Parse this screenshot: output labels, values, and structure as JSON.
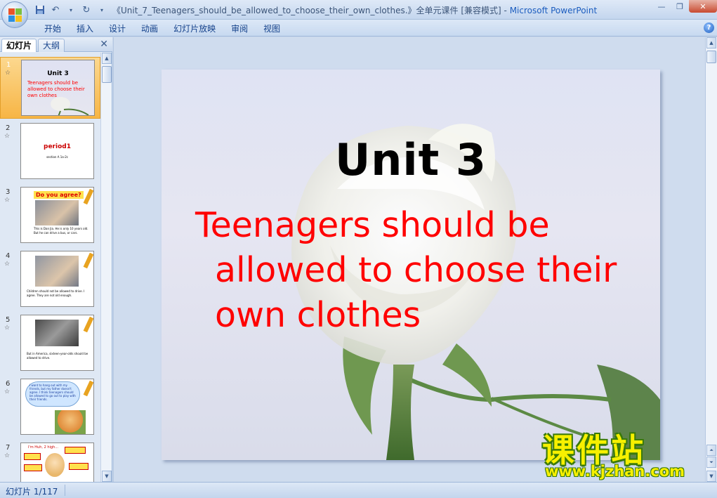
{
  "window": {
    "title": "《Unit_7_Teenagers_should_be_allowed_to_choose_their_own_clothes.》全单元课件 [兼容模式]",
    "app_name": "Microsoft PowerPoint",
    "minimize": "—",
    "maximize": "❐",
    "close": "✕"
  },
  "ribbon": {
    "tabs": [
      "开始",
      "插入",
      "设计",
      "动画",
      "幻灯片放映",
      "审阅",
      "视图"
    ],
    "help": "?"
  },
  "left_pane": {
    "tab_slides": "幻灯片",
    "tab_outline": "大纲",
    "close": "✕",
    "slides": [
      {
        "num": "1",
        "title": "Unit 3",
        "subtitle": "Teenagers should be allowed to choose their own clothes"
      },
      {
        "num": "2",
        "title": "period1",
        "subtitle": "section A 1a-2c"
      },
      {
        "num": "3",
        "title": "Do you agree?",
        "subtitle": "This is Dan Jia. He is only 10 years old. But he can drive a bus, or cars."
      },
      {
        "num": "4",
        "title": "",
        "subtitle": "Children should not be allowed to drive. I agree. They are not old enough."
      },
      {
        "num": "5",
        "title": "",
        "subtitle": "But in America, sixteen-year-olds should be allowed to drive."
      },
      {
        "num": "6",
        "title": "",
        "subtitle": "I want to hang out with my friends, but my father doesn't agree. I think teenagers should be allowed to go out to play with their friends."
      },
      {
        "num": "7",
        "title": "I'm Huh, 2 high...",
        "subtitle": ""
      }
    ]
  },
  "slide": {
    "title": "Unit 3",
    "body_line1": "Teenagers should be",
    "body_line2": "allowed to choose their",
    "body_line3": "own clothes"
  },
  "watermark": {
    "cn": "课件站",
    "url": "www.kjzhan.com"
  },
  "status": {
    "slide_counter": "幻灯片 1/117"
  },
  "colors": {
    "accent": "#15428b",
    "title_color": "#000000",
    "body_color": "#ff0000",
    "selected_thumb": "#f7b545"
  }
}
